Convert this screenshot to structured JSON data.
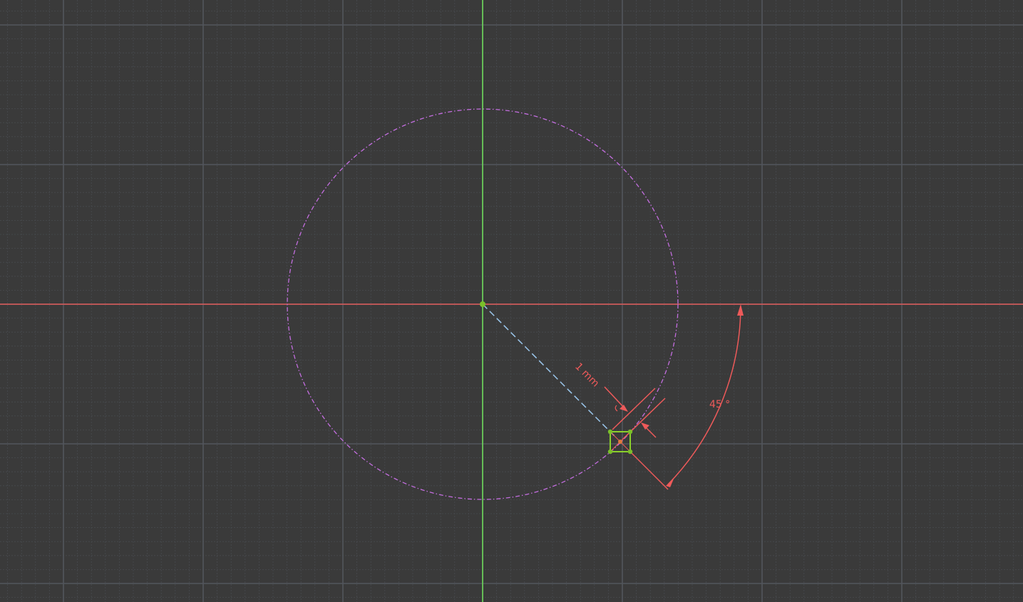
{
  "sketch": {
    "constraints": {
      "distance_label": "1 mm",
      "angle_label": "45 °"
    }
  },
  "colors": {
    "background": "#3a3a3a",
    "grid_major": "#52565c",
    "grid_minor": "#474a4e",
    "axis_h": "#e05a5a",
    "axis_v": "#6fe15a",
    "construction_circle": "#c46ee0",
    "construction_line": "#9cc8ee",
    "dimension": "#ee5a5a",
    "point": "#7abf2a",
    "selection_square": "#8cd12a"
  },
  "icons": {
    "origin": "origin-point-icon",
    "angle_constraint": "angle-constraint-icon"
  }
}
